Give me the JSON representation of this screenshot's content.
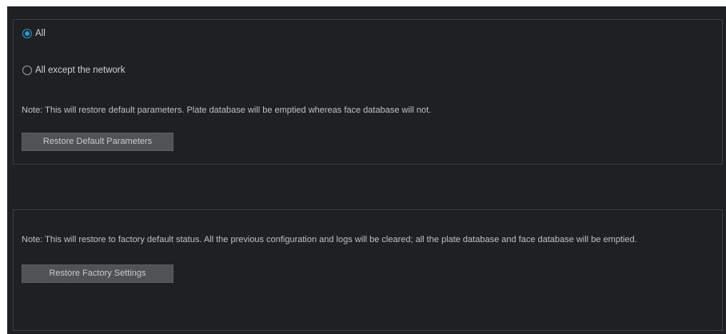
{
  "restore_default": {
    "options": [
      {
        "label": "All",
        "selected": true
      },
      {
        "label": "All except the network",
        "selected": false
      }
    ],
    "note": "Note: This will restore default parameters. Plate database will be emptied whereas face database will not.",
    "button_label": "Restore Default Parameters"
  },
  "restore_factory": {
    "note": "Note: This will restore to factory default status. All the previous configuration and logs will be cleared; all the plate database and face database will be emptied.",
    "button_label": "Restore Factory Settings"
  },
  "colors": {
    "background": "#1f2021",
    "panel_border": "#3c3d3f",
    "accent": "#2a9ad0",
    "button_bg": "#505254",
    "text": "#cfd0d1"
  },
  "icons": {
    "radio_selected": "radio-selected-icon",
    "radio_unselected": "radio-unselected-icon"
  }
}
